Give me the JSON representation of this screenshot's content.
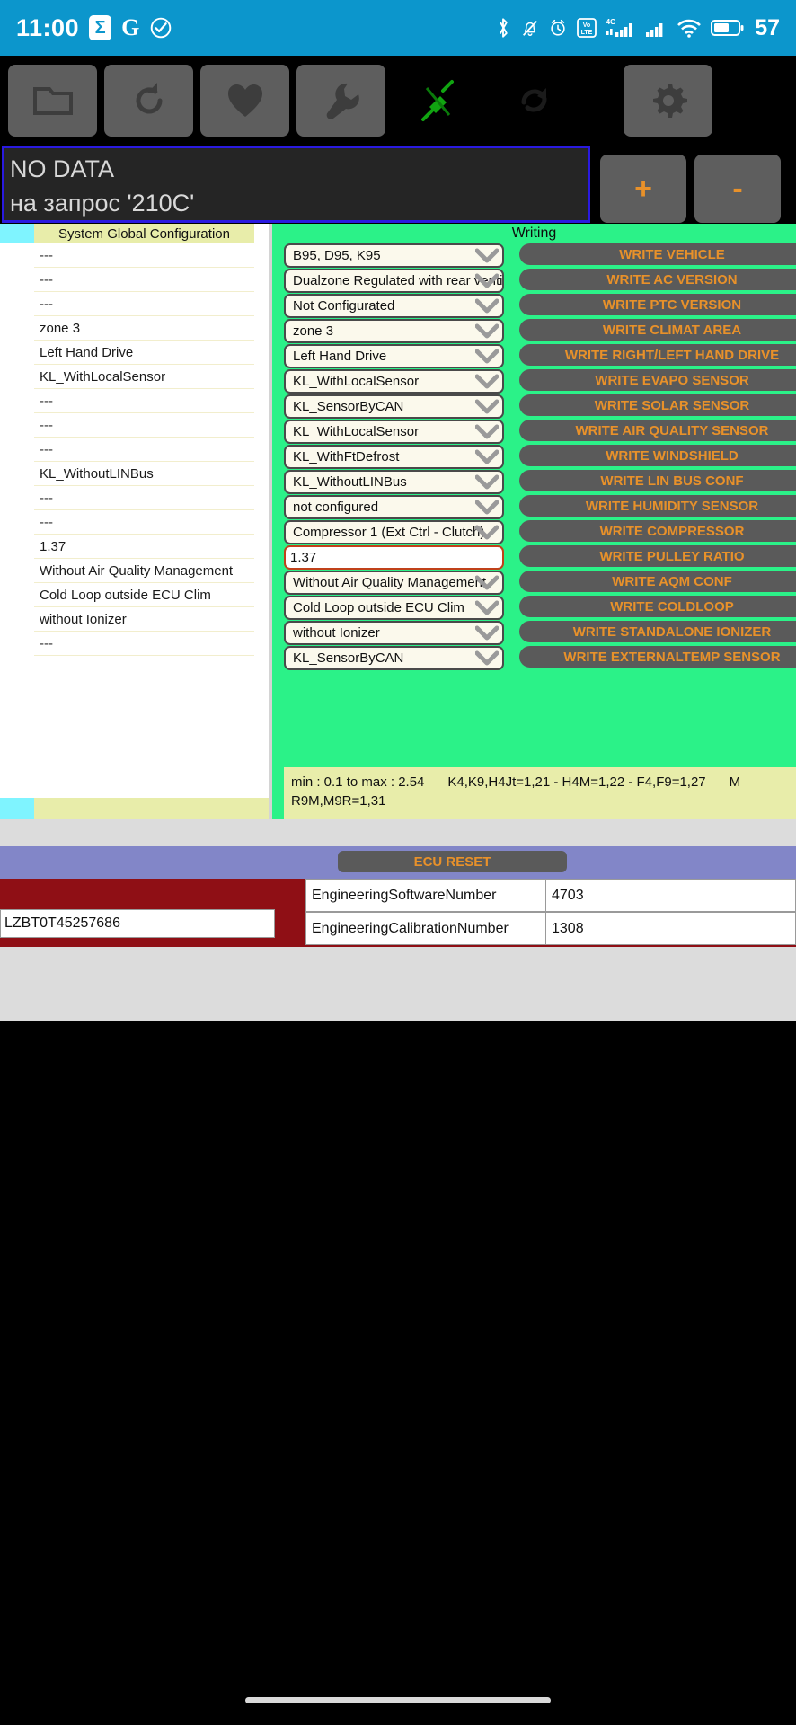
{
  "statusbar": {
    "time": "11:00",
    "battery_percent": "57",
    "battery_unit": "%",
    "icons_left": [
      "sigma-app-icon",
      "google-icon",
      "check-circle-icon"
    ],
    "icons_right": [
      "bluetooth-icon",
      "mute-bell-icon",
      "alarm-icon",
      "volte-icon",
      "signal-4g-icon",
      "signal-icon",
      "wifi-icon",
      "battery-icon"
    ],
    "accent": "#0c96cc"
  },
  "toolbar": {
    "buttons": [
      {
        "name": "folder-icon",
        "label": "folder"
      },
      {
        "name": "refresh-icon",
        "label": "refresh"
      },
      {
        "name": "heart-icon",
        "label": "favorites"
      },
      {
        "name": "wrench-icon",
        "label": "tools"
      },
      {
        "name": "plug-connected-icon",
        "label": "connected"
      },
      {
        "name": "sync-icon",
        "label": "sync"
      },
      {
        "name": "gear-icon",
        "label": "settings"
      }
    ],
    "plug_color": "#11a411"
  },
  "message": {
    "line1": "NO DATA",
    "line2": "на запрос '210C'",
    "border_color": "#2a1ae0"
  },
  "stepper": {
    "plus": "+",
    "minus": "-"
  },
  "left_table": {
    "header": "System Global Configuration",
    "rows": [
      "---",
      "---",
      "---",
      "zone 3",
      "Left Hand Drive",
      "KL_WithLocalSensor",
      "---",
      "---",
      "---",
      "KL_WithoutLINBus",
      "---",
      "---",
      "1.37",
      "Without Air Quality Management",
      "Cold Loop outside ECU Clim",
      "without Ionizer",
      "---"
    ]
  },
  "writing_pane": {
    "title": "Writing",
    "dropdowns": [
      {
        "value": "B95, D95, K95",
        "type": "select"
      },
      {
        "value": "Dualzone Regulated with rear ventil",
        "type": "select"
      },
      {
        "value": "Not Configurated",
        "type": "select"
      },
      {
        "value": "zone 3",
        "type": "select"
      },
      {
        "value": "Left Hand Drive",
        "type": "select"
      },
      {
        "value": "KL_WithLocalSensor",
        "type": "select"
      },
      {
        "value": "KL_SensorByCAN",
        "type": "select"
      },
      {
        "value": "KL_WithLocalSensor",
        "type": "select"
      },
      {
        "value": "KL_WithFtDefrost",
        "type": "select"
      },
      {
        "value": "KL_WithoutLINBus",
        "type": "select"
      },
      {
        "value": "not configured",
        "type": "select"
      },
      {
        "value": "Compressor 1 (Ext Ctrl - Clutch)",
        "type": "select"
      },
      {
        "value": "1.37",
        "type": "text"
      },
      {
        "value": "Without Air Quality Management",
        "type": "select"
      },
      {
        "value": "Cold Loop outside ECU Clim",
        "type": "select"
      },
      {
        "value": "without Ionizer",
        "type": "select"
      },
      {
        "value": "KL_SensorByCAN",
        "type": "select"
      }
    ],
    "write_buttons": [
      "WRITE VEHICLE",
      "WRITE AC VERSION",
      "WRITE PTC VERSION",
      "WRITE CLIMAT AREA",
      "WRITE RIGHT/LEFT HAND DRIVE",
      "WRITE EVAPO SENSOR",
      "WRITE SOLAR SENSOR",
      "WRITE AIR QUALITY SENSOR",
      "WRITE WINDSHIELD",
      "WRITE LIN BUS CONF",
      "WRITE HUMIDITY SENSOR",
      "WRITE COMPRESSOR",
      "WRITE PULLEY RATIO",
      "WRITE AQM CONF",
      "WRITE COLDLOOP",
      "WRITE STANDALONE IONIZER",
      "WRITE EXTERNALTEMP SENSOR"
    ],
    "footer": {
      "range": "min : 0.1 to max : 2.54",
      "note1": "K4,K9,H4Jt=1,21 - H4M=1,22 - F4,F9=1,27",
      "note2": "M",
      "note3": "R9M,M9R=1,31"
    },
    "bg_color": "#2bf288",
    "button_text_color": "#e8912a"
  },
  "ecu": {
    "reset_label": "ECU RESET"
  },
  "vehicle": {
    "vin": "LZBT0T45257686",
    "engineering": [
      {
        "key": "EngineeringSoftwareNumber",
        "value": "4703"
      },
      {
        "key": "EngineeringCalibrationNumber",
        "value": "1308"
      }
    ]
  }
}
